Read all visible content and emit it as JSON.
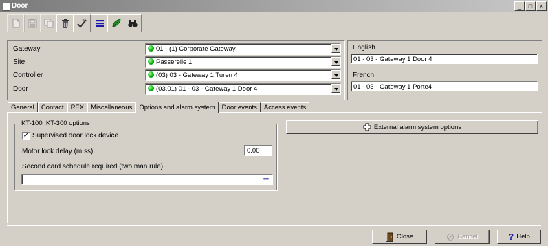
{
  "window": {
    "title": "Door",
    "min_label": "_",
    "max_label": "□",
    "close_label": "×"
  },
  "toolbar": {
    "buttons": [
      {
        "name": "new-icon",
        "enabled": false
      },
      {
        "name": "save-icon",
        "enabled": false
      },
      {
        "name": "copy-icon",
        "enabled": false
      },
      {
        "name": "delete-icon",
        "enabled": true
      },
      {
        "name": "edit-icon",
        "enabled": true
      },
      {
        "name": "list-icon",
        "enabled": true
      },
      {
        "name": "link-icon",
        "enabled": true
      },
      {
        "name": "binoculars-icon",
        "enabled": true
      }
    ]
  },
  "fields": {
    "gateway": {
      "label": "Gateway",
      "value": "01 - (1)  Corporate Gateway"
    },
    "site": {
      "label": "Site",
      "value": "Passerelle 1"
    },
    "controller": {
      "label": "Controller",
      "value": "(03) 03 - Gateway 1 Turen 4"
    },
    "door": {
      "label": "Door",
      "value": "(03.01) 01 - 03 - Gateway 1 Door 4"
    }
  },
  "languages": {
    "english": {
      "label": "English",
      "value": "01 - 03 - Gateway 1 Door 4"
    },
    "french": {
      "label": "French",
      "value": "01 - 03 - Gateway 1 Porte4"
    }
  },
  "tabs": [
    "General",
    "Contact",
    "REX",
    "Miscellaneous",
    "Options and alarm system",
    "Door events",
    "Access events"
  ],
  "active_tab": "Options and alarm system",
  "options": {
    "group_title": "KT-100 ,KT-300 options",
    "supervised_label": "Supervised door lock device",
    "supervised_checked": true,
    "check_mark": "✓",
    "motor_delay_label": "Motor lock delay (m.ss)",
    "motor_delay_value": "0.00",
    "second_card_label": "Second card schedule required (two man rule)",
    "second_card_value": "",
    "browse_label": "•••",
    "external_alarm_label": "External alarm system options"
  },
  "footer": {
    "close_label": "Close",
    "cancel_label": "Cancel",
    "help_label": "Help"
  }
}
